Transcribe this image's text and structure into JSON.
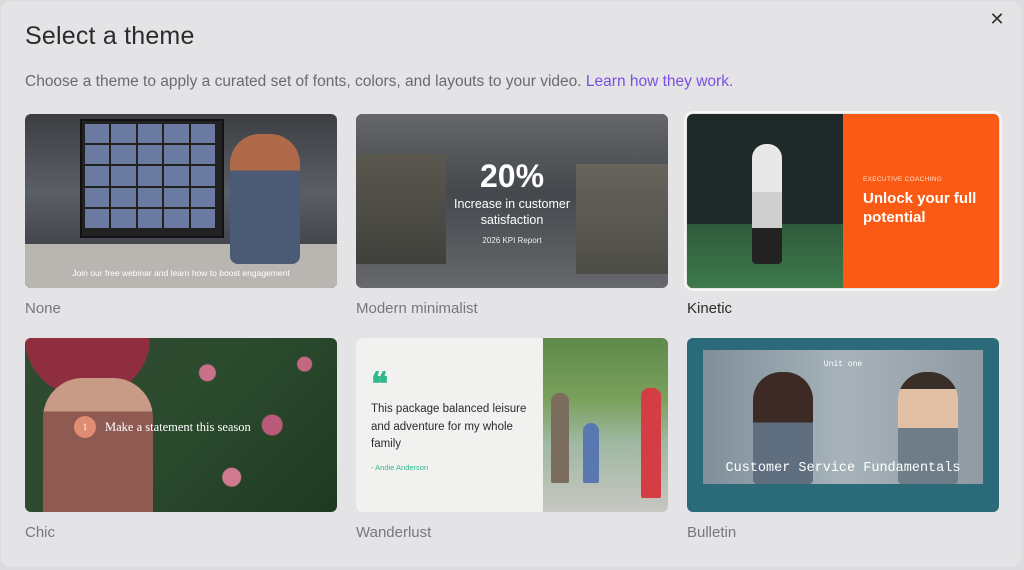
{
  "dialog": {
    "title": "Select a theme",
    "subtitle": "Choose a theme to apply a curated set of fonts, colors, and layouts to your video.",
    "learn_link": "Learn how they work.",
    "close_glyph": "✕"
  },
  "themes": [
    {
      "label": "None",
      "caption": "Join our free webinar and learn how to boost engagement"
    },
    {
      "label": "Modern minimalist",
      "big": "20%",
      "mid": "Increase in customer satisfaction",
      "small": "2026 KPI Report"
    },
    {
      "label": "Kinetic",
      "kicker": "EXECUTIVE COACHING",
      "headline": "Unlock your full potential",
      "selected": true
    },
    {
      "label": "Chic",
      "number": "1",
      "statement": "Make a statement this season"
    },
    {
      "label": "Wanderlust",
      "quote_mark": "❝",
      "quote": "This package balanced leisure and adventure for my whole family",
      "author": "- Andie Anderson"
    },
    {
      "label": "Bulletin",
      "unit": "Unit one",
      "title": "Customer Service Fundamentals"
    }
  ],
  "colors": {
    "accent_link": "#7b4fe0",
    "kinetic_orange": "#fa5a14",
    "wanderlust_green": "#2fb98a",
    "bulletin_teal": "#2b6a78"
  }
}
